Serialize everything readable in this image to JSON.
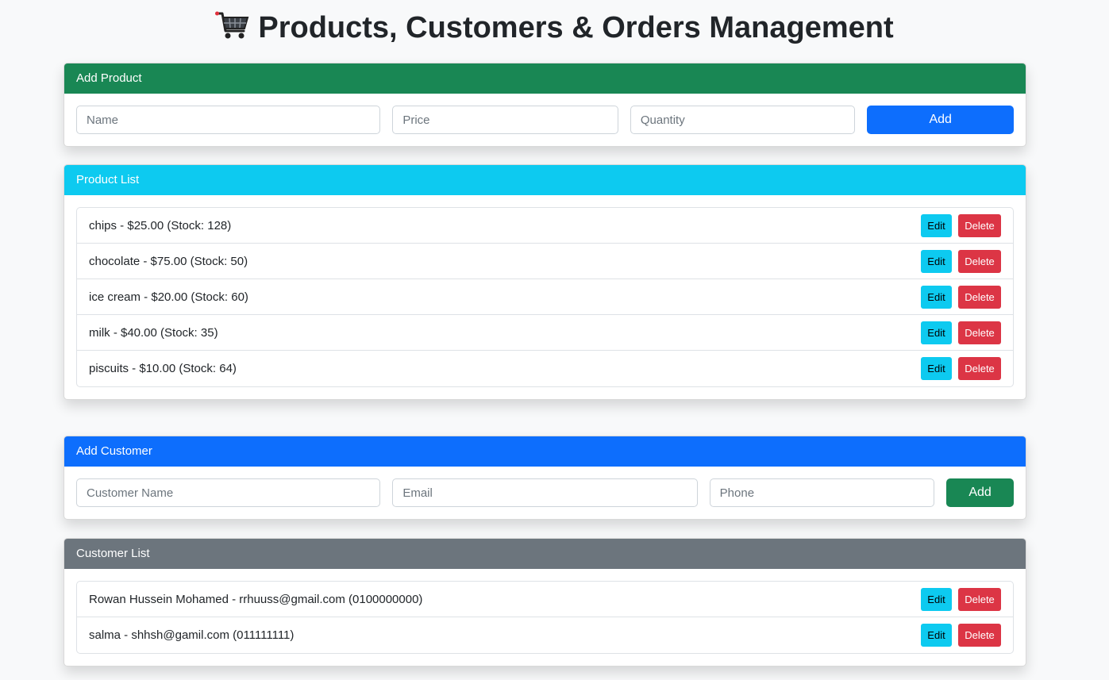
{
  "header": {
    "title": "Products, Customers & Orders Management",
    "icon": "shopping-cart-icon"
  },
  "colors": {
    "success": "#198754",
    "info": "#0dcaf0",
    "primary": "#0d6efd",
    "secondary": "#6c757d",
    "danger": "#dc3545",
    "background": "#f8f9fa"
  },
  "add_product": {
    "title": "Add Product",
    "name_placeholder": "Name",
    "price_placeholder": "Price",
    "quantity_placeholder": "Quantity",
    "add_label": "Add"
  },
  "product_list": {
    "title": "Product List",
    "items": [
      {
        "text": "chips - $25.00 (Stock: 128)",
        "edit": "Edit",
        "delete": "Delete"
      },
      {
        "text": "chocolate - $75.00 (Stock: 50)",
        "edit": "Edit",
        "delete": "Delete"
      },
      {
        "text": "ice cream - $20.00 (Stock: 60)",
        "edit": "Edit",
        "delete": "Delete"
      },
      {
        "text": "milk - $40.00 (Stock: 35)",
        "edit": "Edit",
        "delete": "Delete"
      },
      {
        "text": "piscuits - $10.00 (Stock: 64)",
        "edit": "Edit",
        "delete": "Delete"
      }
    ]
  },
  "add_customer": {
    "title": "Add Customer",
    "name_placeholder": "Customer Name",
    "email_placeholder": "Email",
    "phone_placeholder": "Phone",
    "add_label": "Add"
  },
  "customer_list": {
    "title": "Customer List",
    "items": [
      {
        "text": "Rowan Hussein Mohamed - rrhuuss@gmail.com (0100000000)",
        "edit": "Edit",
        "delete": "Delete"
      },
      {
        "text": "salma - shhsh@gamil.com (011111111)",
        "edit": "Edit",
        "delete": "Delete"
      }
    ]
  }
}
